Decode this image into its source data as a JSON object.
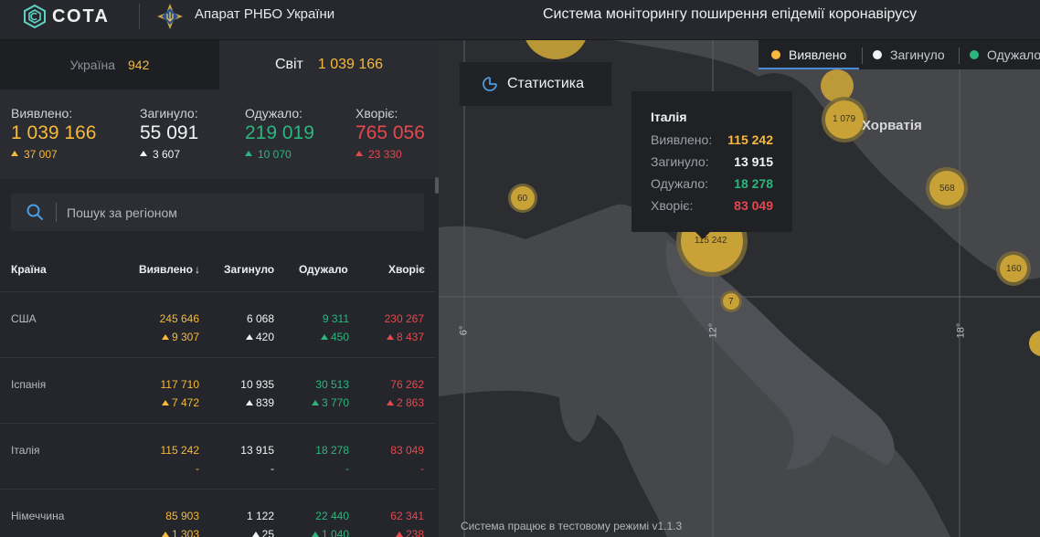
{
  "header": {
    "logo_text": "СОТА",
    "org_name": "Апарат РНБО України",
    "site_title": "Система моніторингу поширення епідемії коронавірусу"
  },
  "tabs": {
    "ukraine": {
      "label": "Україна",
      "value": "942"
    },
    "world": {
      "label": "Світ",
      "value": "1 039 166"
    }
  },
  "stats": {
    "confirmed": {
      "label": "Виявлено:",
      "value": "1 039 166",
      "delta": "37 007"
    },
    "deaths": {
      "label": "Загинуло:",
      "value": "55 091",
      "delta": "3 607"
    },
    "recovered": {
      "label": "Одужало:",
      "value": "219 019",
      "delta": "10 070"
    },
    "sick": {
      "label": "Хворіє:",
      "value": "765 056",
      "delta": "23 330"
    }
  },
  "search": {
    "placeholder": "Пошук за регіоном"
  },
  "table": {
    "headers": {
      "country": "Країна",
      "confirmed": "Виявлено",
      "deaths": "Загинуло",
      "recovered": "Одужало",
      "sick": "Хворіє"
    },
    "rows": [
      {
        "name": "США",
        "confirmed": "245 646",
        "confirmed_d": "9 307",
        "deaths": "6 068",
        "deaths_d": "420",
        "recovered": "9 311",
        "recovered_d": "450",
        "sick": "230 267",
        "sick_d": "8 437",
        "has_delta": true
      },
      {
        "name": "Іспанія",
        "confirmed": "117 710",
        "confirmed_d": "7 472",
        "deaths": "10 935",
        "deaths_d": "839",
        "recovered": "30 513",
        "recovered_d": "3 770",
        "sick": "76 262",
        "sick_d": "2 863",
        "has_delta": true
      },
      {
        "name": "Італія",
        "confirmed": "115 242",
        "confirmed_d": "-",
        "deaths": "13 915",
        "deaths_d": "-",
        "recovered": "18 278",
        "recovered_d": "-",
        "sick": "83 049",
        "sick_d": "-",
        "has_delta": false
      },
      {
        "name": "Німеччина",
        "confirmed": "85 903",
        "confirmed_d": "1 303",
        "deaths": "1 122",
        "deaths_d": "25",
        "recovered": "22 440",
        "recovered_d": "1 040",
        "sick": "62 341",
        "sick_d": "238",
        "has_delta": true
      }
    ]
  },
  "map": {
    "stat_button": "Статистика",
    "legend": {
      "confirmed": "Виявлено",
      "deaths": "Загинуло",
      "recovered": "Одужало"
    },
    "labels": {
      "croatia": "Хорватія",
      "lon6": "6°",
      "lon12": "12°",
      "lon18": "18°"
    },
    "bubbles": {
      "italy": "115 242",
      "croatia": "1 079",
      "b60": "60",
      "b568": "568",
      "b160": "160",
      "b7": "7"
    },
    "tooltip": {
      "title": "Італія",
      "confirmed_label": "Виявлено:",
      "confirmed": "115 242",
      "deaths_label": "Загинуло:",
      "deaths": "13 915",
      "recovered_label": "Одужало:",
      "recovered": "18 278",
      "sick_label": "Хворіє:",
      "sick": "83 049"
    },
    "footer": "Система працює в тестовому режимі v1.1.3"
  },
  "colors": {
    "confirmed": "#f6b93b",
    "deaths": "#f2f3f5",
    "recovered": "#2cb67d",
    "sick": "#e5484d",
    "accent": "#4b8bd6"
  }
}
